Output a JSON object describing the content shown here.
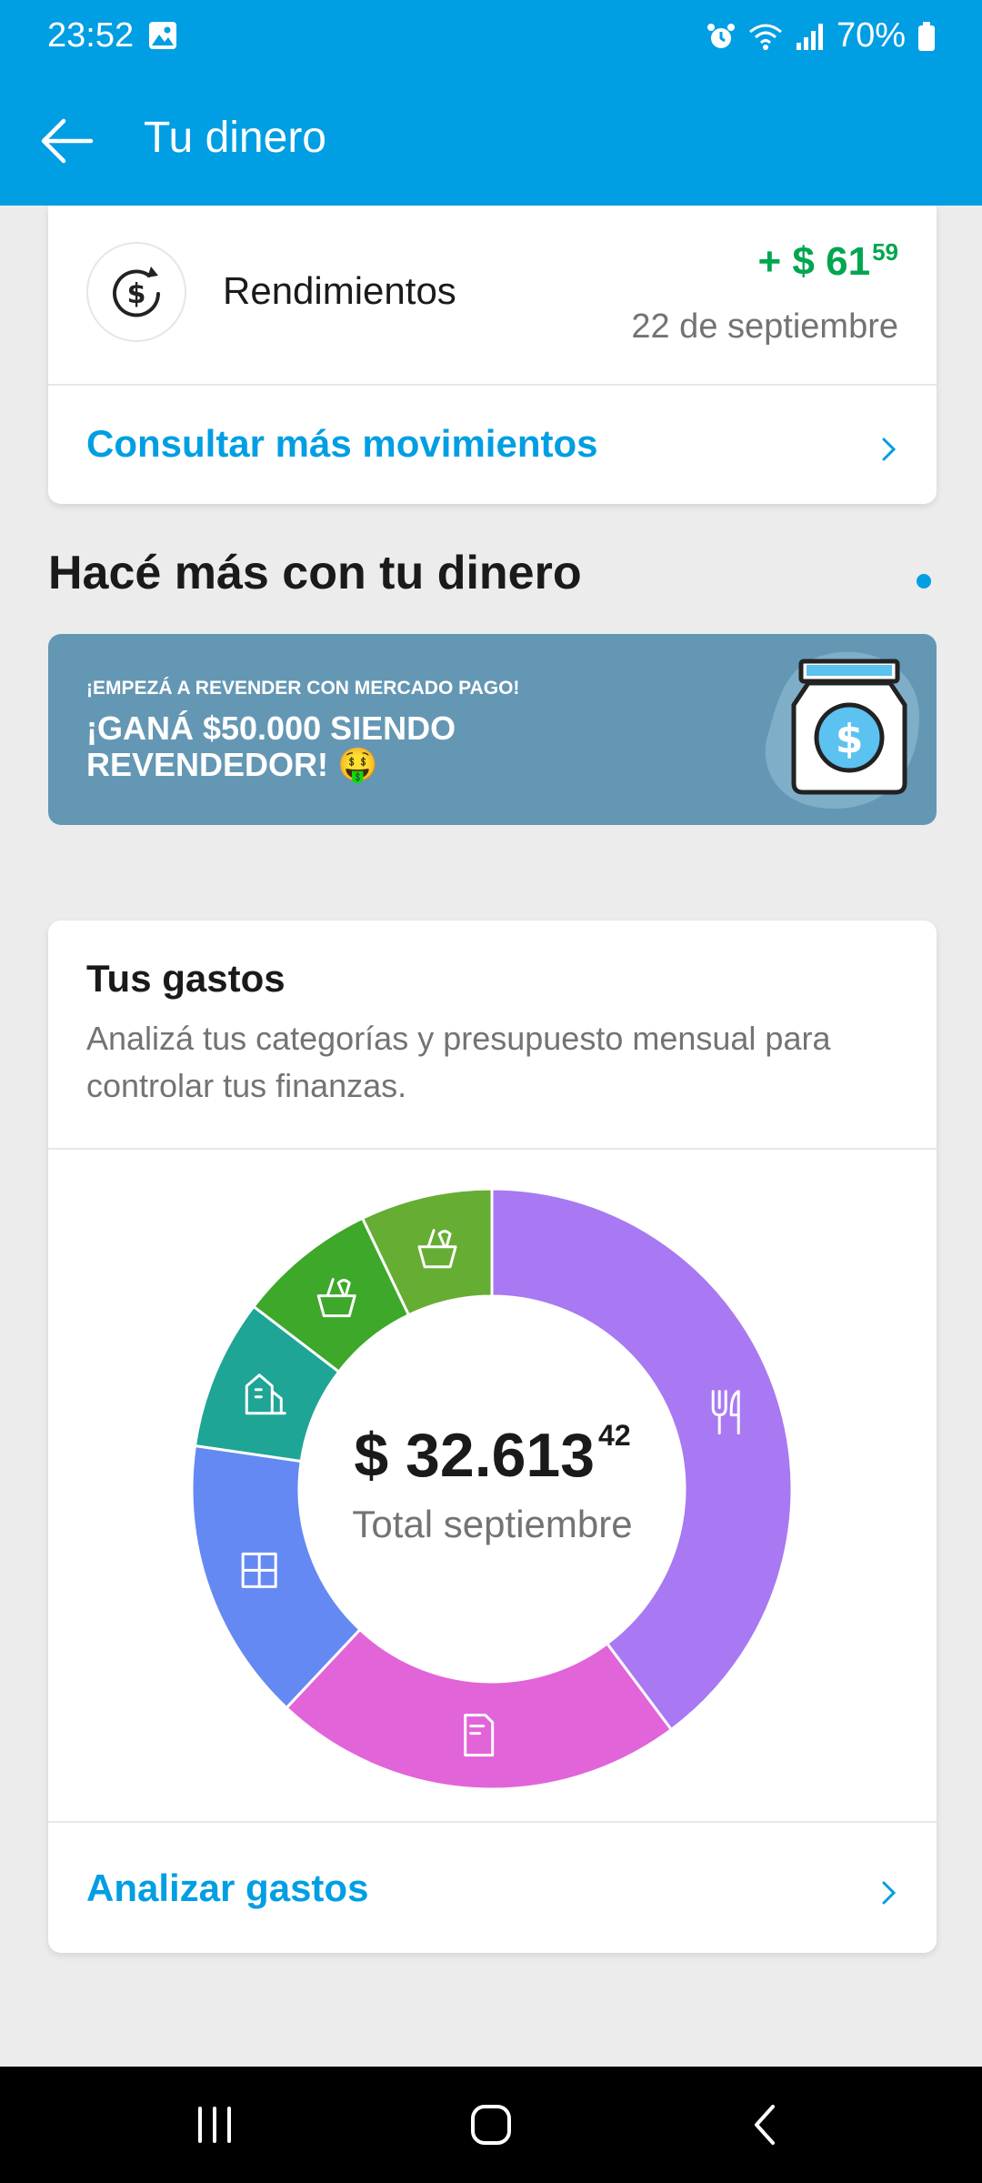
{
  "status_bar": {
    "time": "23:52",
    "battery": "70%"
  },
  "header": {
    "title": "Tu dinero"
  },
  "movement": {
    "name": "Rendimientos",
    "amount_prefix": "+ $ 61",
    "amount_cents": "59",
    "date": "22 de septiembre",
    "more_link": "Consultar más movimientos"
  },
  "section": {
    "title": "Hacé más con tu dinero"
  },
  "banner": {
    "small_text": "¡EMPEZÁ A REVENDER CON MERCADO PAGO!",
    "big_text": "¡GANÁ $50.000 SIENDO REVENDEDOR! 🤑"
  },
  "expenses": {
    "title": "Tus gastos",
    "description": "Analizá tus categorías y presupuesto mensual para controlar tus finanzas.",
    "total_main": "$ 32.613",
    "total_cents": "42",
    "total_label": "Total septiembre",
    "link": "Analizar gastos"
  },
  "chart_data": {
    "type": "pie",
    "donut": true,
    "values": [
      39.8,
      22.2,
      15.3,
      8.1,
      7.5,
      7.1
    ],
    "colors": [
      "#a879f2",
      "#e264d9",
      "#6489f2",
      "#1ea596",
      "#3da82a",
      "#66ad33"
    ],
    "icons": [
      "fork-knife-icon",
      "receipt-dollar-icon",
      "grid-icon",
      "home-city-icon",
      "basket-icon",
      "basket-icon"
    ]
  }
}
